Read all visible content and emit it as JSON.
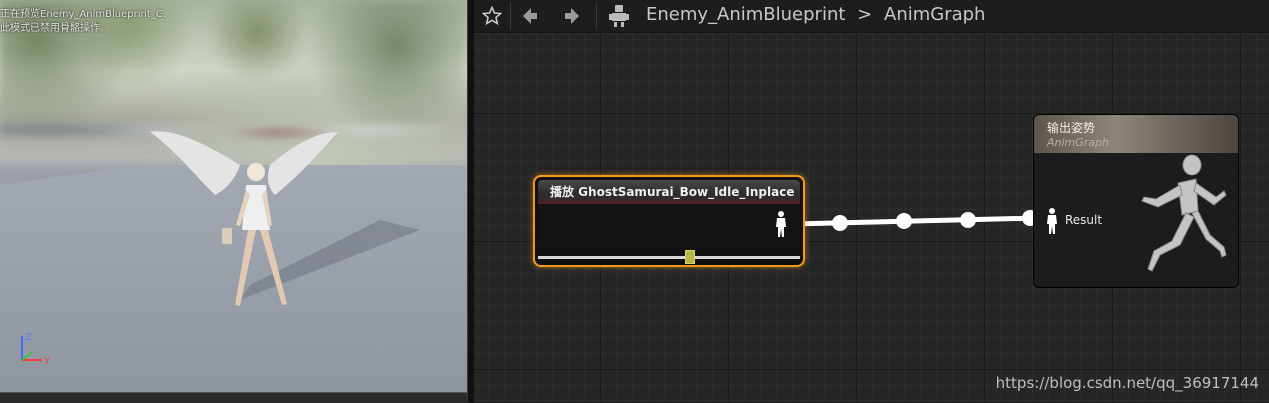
{
  "viewport": {
    "overlay_line1": "正在预览Enemy_AnimBlueprint_C.",
    "overlay_line2": "此模式已禁用骨骼操作。",
    "axis_z_label": "Z",
    "axis_y_label": "Y"
  },
  "toolbar": {
    "favorite_icon": "star-icon",
    "back_icon": "arrow-left-icon",
    "forward_icon": "arrow-right-icon",
    "blueprint_icon": "robot-icon",
    "breadcrumb_root": "Enemy_AnimBlueprint",
    "breadcrumb_separator": ">",
    "breadcrumb_current": "AnimGraph"
  },
  "play_node": {
    "title": "播放 GhostSamurai_Bow_Idle_Inplace",
    "output_pin_icon": "pose-pin-icon"
  },
  "result_node": {
    "title": "输出姿势",
    "subtitle": "AnimGraph",
    "pin_label": "Result",
    "preview_icon": "running-mannequin-icon"
  },
  "watermark": "https://blog.csdn.net/qq_36917144",
  "colors": {
    "selection_outline": "#f29a1a",
    "wire": "#ffffff",
    "grid_major": "#1a1a1a",
    "grid_minor": "#2e2e2e"
  }
}
